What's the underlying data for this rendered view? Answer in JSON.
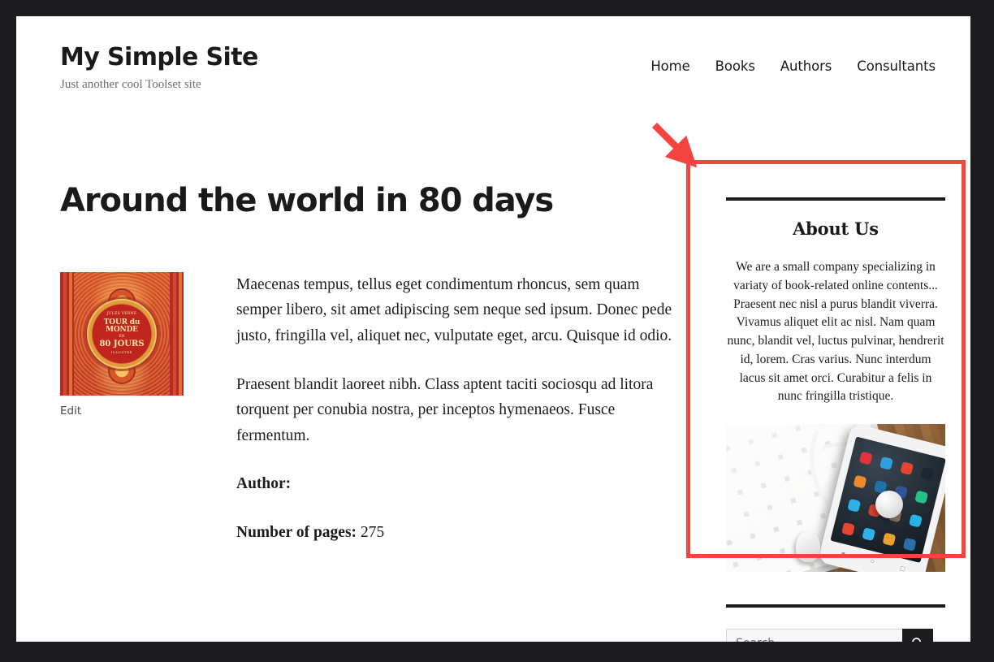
{
  "site": {
    "title": "My Simple Site",
    "tagline": "Just another cool Toolset site"
  },
  "nav": {
    "items": [
      {
        "label": "Home"
      },
      {
        "label": "Books"
      },
      {
        "label": "Authors"
      },
      {
        "label": "Consultants"
      }
    ]
  },
  "main": {
    "entry_title": "Around the world in 80 days",
    "cover": {
      "alt": "book-cover-tour-du-monde",
      "medallion": {
        "author": "JULES VERNE",
        "title": "TOUR du MONDE",
        "sub": "EN",
        "days": "80 JOURS",
        "foot": "ILLUSTRE"
      }
    },
    "edit_link": "Edit",
    "paragraphs": [
      "Maecenas tempus, tellus eget condimentum rhoncus, sem quam semper libero, sit amet adipiscing sem neque sed ipsum. Donec pede justo, fringilla vel, aliquet nec, vulputate eget, arcu. Quisque id odio.",
      "Praesent blandit laoreet nibh. Class aptent taciti sociosqu ad litora torquent per conubia nostra, per inceptos hymenaeos. Fusce fermentum."
    ],
    "fields": [
      {
        "label": "Author:",
        "value": ""
      },
      {
        "label": "Number of pages:",
        "value": "275"
      }
    ]
  },
  "sidebar": {
    "about_widget": {
      "title": "About Us",
      "body": "We are a small company specializing in variaty of book-related online contents... Praesent nec nisl a purus blandit viverra. Vivamus aliquet elit ac nisl. Nam quam nunc, blandit vel, luctus pulvinar, hendrerit id, lorem. Cras varius. Nunc interdum lacus sit amet orci. Curabitur a felis in nunc fringilla tristique.",
      "image_alt": "keyboard-smartphone-earbuds-photo"
    },
    "search_widget": {
      "placeholder": "Search …",
      "value": "",
      "submit_icon": "search-icon"
    }
  },
  "annotation": {
    "highlight_color": "#f4443f",
    "arrow_icon": "arrow-down-right-icon",
    "target": "about-us-widget"
  },
  "theme": {
    "frame_color": "#1c1c1e",
    "page_background": "#ffffff",
    "text_color": "#1c1c1c",
    "rule_color": "#1a1a1a"
  }
}
